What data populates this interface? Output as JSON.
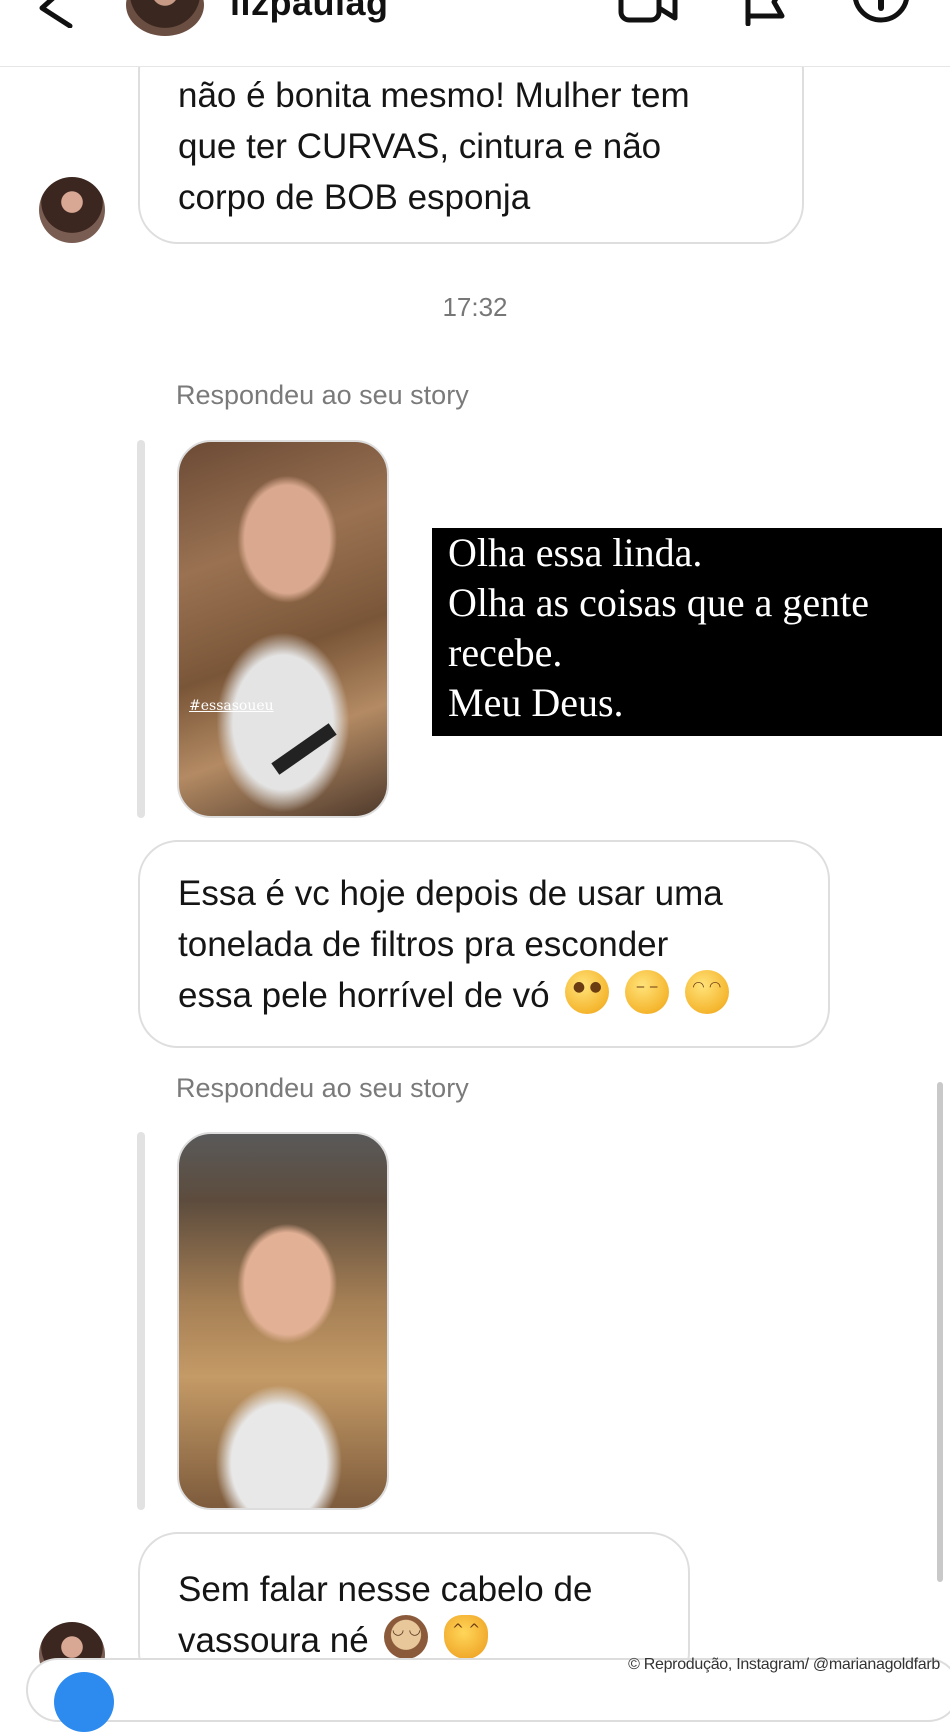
{
  "header": {
    "username": "lizpaulag",
    "back_icon": "chevron-left-icon",
    "video_icon": "video-call-icon",
    "flag_icon": "flag-icon",
    "info_icon": "info-icon"
  },
  "messages": {
    "first_bubble_lines": [
      "não é bonita mesmo! Mulher tem",
      "que ter CURVAS, cintura e não",
      "corpo de BOB esponja"
    ],
    "timestamp": "17:32",
    "story_reply_1": {
      "label": "Respondeu ao seu story",
      "story_tag": "#essasoueu",
      "caption_lines": [
        "Olha essa linda.",
        "Olha as coisas que a gente",
        "recebe.",
        "Meu Deus."
      ]
    },
    "second_bubble_lines": [
      "Essa é vc hoje depois de usar uma",
      "tonelada de filtros pra esconder",
      "essa pele horrível de vó"
    ],
    "second_bubble_emojis": [
      "face-with-rolling-eyes",
      "unamused-face",
      "face-with-hand-over-mouth"
    ],
    "story_reply_2": {
      "label": "Respondeu ao seu story"
    },
    "third_bubble_lines": [
      "Sem falar nesse cabelo de",
      "vassoura né"
    ],
    "third_bubble_emojis": [
      "see-no-evil-monkey",
      "cat-with-tears-of-joy"
    ]
  },
  "credit": "© Reprodução, Instagram/ @marianagoldfarb"
}
